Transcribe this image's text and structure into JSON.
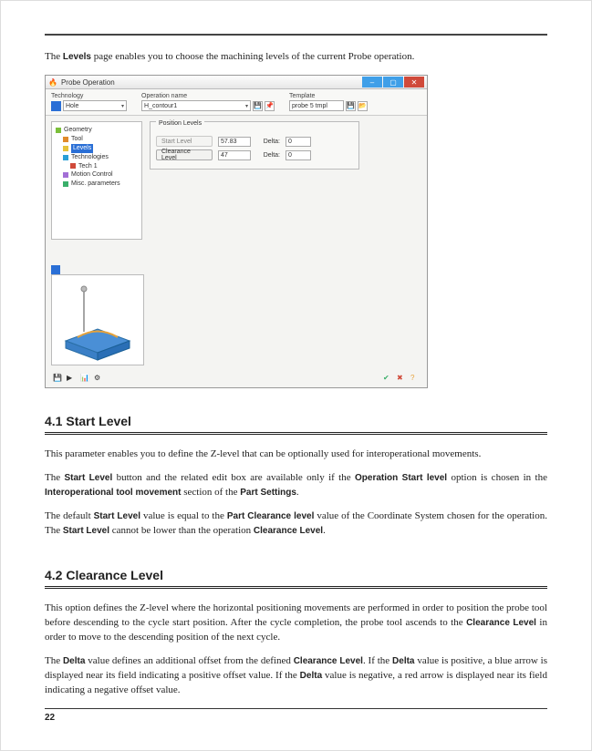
{
  "intro": {
    "pre": "The ",
    "b1": "Levels",
    "post": " page enables you to choose the machining levels of the current Probe operation."
  },
  "sshot": {
    "title": "Probe Operation",
    "toolbar": {
      "tech_label": "Technology",
      "tech_value": "Hole",
      "opname_label": "Operation name",
      "opname_value": "H_contour1",
      "template_label": "Template",
      "template_value": "probe 5 tmpl"
    },
    "tree": {
      "geometry": "Geometry",
      "tool": "Tool",
      "levels": "Levels",
      "technologies": "Technologies",
      "tech1": "Tech 1",
      "motion": "Motion Control",
      "misc": "Misc. parameters"
    },
    "levels_group": {
      "title": "Position Levels",
      "start_btn": "Start Level",
      "start_val": "57.83",
      "delta_label": "Delta:",
      "delta1": "0",
      "clear_btn": "Clearance Level",
      "clear_val": "47",
      "delta2": "0"
    }
  },
  "s41": {
    "heading": "4.1   Start Level",
    "p1": "This parameter enables you to define the Z-level that can be optionally used for interoperational movements.",
    "p2": {
      "t1": "The ",
      "b1": "Start Level",
      "t2": " button and the related edit box are available only if the ",
      "b2": "Operation Start level",
      "t3": " option is chosen in the ",
      "b3": "Interoperational tool movement",
      "t4": " section of the ",
      "b4": "Part Settings",
      "t5": "."
    },
    "p3": {
      "t1": "The default ",
      "b1": "Start Level",
      "t2": " value is equal to the ",
      "b2": "Part Clearance level",
      "t3": " value of the Coordinate System chosen for the operation. The ",
      "b3": "Start Level",
      "t4": " cannot be lower than the operation ",
      "b4": "Clearance Level",
      "t5": "."
    }
  },
  "s42": {
    "heading": "4.2   Clearance Level",
    "p1": {
      "t1": "This option defines the Z-level where the horizontal positioning movements are performed in order to position the probe tool before descending to the cycle start position. After the cycle completion, the probe tool ascends to the ",
      "b1": "Clearance Level",
      "t2": " in order to move to the descending position of the next cycle."
    },
    "p2": {
      "t1": "The ",
      "b1": "Delta",
      "t2": " value defines an additional offset from the defined ",
      "b2": "Clearance Level",
      "t3": ". If the ",
      "b3": "Delta",
      "t4": " value is positive, a blue arrow is displayed near its field indicating a positive offset value. If the ",
      "b4": "Delta",
      "t5": " value is negative, a red arrow is displayed near its field indicating a negative offset value."
    }
  },
  "page_number": "22"
}
